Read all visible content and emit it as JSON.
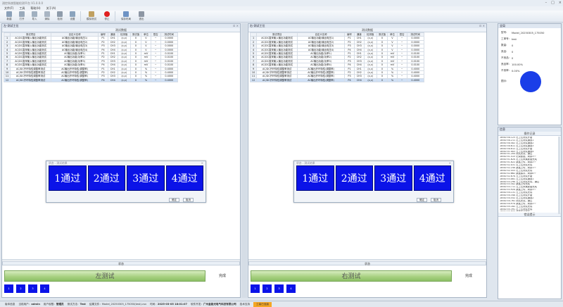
{
  "window": {
    "title": "测控系统智能检测平台 V1.0.0.0"
  },
  "menu": [
    "文件(F)",
    "工具",
    "帮助(H)",
    "关于(A)"
  ],
  "toolbar": [
    {
      "label": "新建",
      "icon": "new-file-icon",
      "color": "#8aa0b8"
    },
    {
      "label": "打开",
      "icon": "open-icon",
      "color": "#9aaabb"
    },
    {
      "label": "导入",
      "icon": "import-icon",
      "color": "#a0b0c0"
    },
    {
      "label": "清除",
      "icon": "clear-icon",
      "color": "#a9b5c3"
    },
    {
      "label": "检测",
      "icon": "check-icon",
      "color": "#8f9cab"
    },
    {
      "label": "设置",
      "icon": "settings-icon",
      "color": "#8aa3bd"
    },
    {
      "label": "模拟测试",
      "icon": "simulate-icon",
      "color": "#c0a060"
    },
    {
      "label": "停止",
      "icon": "stop-icon",
      "color": "#e02020"
    },
    {
      "label": "保存布局",
      "icon": "save-layout-icon",
      "color": "#6e93c4"
    },
    {
      "label": "退出",
      "icon": "exit-icon",
      "color": "#8d96a3"
    }
  ],
  "left": {
    "title": "左-测试工位",
    "section": "测试数据",
    "dialog": {
      "title": "状态 - 测试结果",
      "ok": "确定",
      "cancel": "取消"
    },
    "tiles": [
      "1通过",
      "2通过",
      "3通过",
      "4通过"
    ],
    "state_header": "状态",
    "test_button": "左测试",
    "done": "完成",
    "channels": [
      "1",
      "2",
      "3",
      "4"
    ]
  },
  "right": {
    "title": "右-测试工位",
    "section": "测试数据",
    "dialog": {
      "title": "状态 - 测试结果",
      "ok": "确定",
      "cancel": "取消"
    },
    "tiles": [
      "1通过",
      "2通过",
      "3通过",
      "4通过"
    ],
    "state_header": "状态",
    "test_button": "右测试",
    "done": "完成",
    "channels": [
      "1",
      "2",
      "3",
      "4"
    ]
  },
  "table": {
    "headers": [
      "",
      "测试项目",
      "自定义名称",
      "编号",
      "通道",
      "检测值",
      "测试值",
      "单位",
      "是否",
      "测试时间"
    ],
    "rows": [
      [
        "1",
        "AC/DC直采输入输出功能测试",
        "AC输出功能(输出电压1)",
        "P1",
        "CH1",
        "(x,x)",
        "0",
        "V",
        "~",
        "0.0000"
      ],
      [
        "2",
        "AC/DC直采输入输出功能测试",
        "AC输出功能(输出电压2)",
        "P2",
        "CH2",
        "(x,x)",
        "0",
        "V",
        "~",
        "0.0000"
      ],
      [
        "3",
        "AC/DC直采输入输出功能测试",
        "AC输出功能(输出电压3)",
        "P3",
        "CH3",
        "(x,x)",
        "0",
        "V",
        "~",
        "0.0000"
      ],
      [
        "4",
        "AC/DC直采输入输出功能测试",
        "AC输出功能(输出电压4)",
        "P4",
        "CH4",
        "(x,x)",
        "0",
        "V",
        "~",
        "0.0000"
      ],
      [
        "5",
        "AC/DC直采输入输出功能测试",
        "AC输出功能(功率1)",
        "P1",
        "CH1",
        "(x,x)",
        "0",
        "mV",
        "~",
        "0.0100"
      ],
      [
        "6",
        "AC/DC直采输入输出功能测试",
        "AC输出功能(功率2)",
        "P2",
        "CH2",
        "(x,x)",
        "0",
        "mV",
        "~",
        "0.0100"
      ],
      [
        "7",
        "AC/DC直采输入输出功能测试",
        "AC输出功能(功率3)",
        "P3",
        "CH3",
        "(x,x)",
        "0",
        "mV",
        "~",
        "0.0100"
      ],
      [
        "8",
        "AC/DC直采输入输出功能测试",
        "AC输出功能(功率4)",
        "P4",
        "CH4",
        "(x,x)",
        "0",
        "mV",
        "~",
        "0.0100"
      ],
      [
        "9",
        "AC/DC开环特性调整率测试",
        "AC输出开环特性(调整率)",
        "P1",
        "CH1",
        "(x,x)",
        "0",
        "%",
        "~",
        "0.4000"
      ],
      [
        "10",
        "AC/DC开环特性调整率测试",
        "AC输出开环特性(调整率)",
        "P2",
        "CH2",
        "(x,x)",
        "0",
        "%",
        "~",
        "0.4000"
      ],
      [
        "11",
        "AC/DC开环特性调整率测试",
        "AC输出开环特性(调整率)",
        "P3",
        "CH3",
        "(x,x)",
        "0",
        "%",
        "~",
        "0.4000"
      ],
      [
        "12",
        "AC/DC开环特性调整率测试",
        "AC输出开环特性(调整率)",
        "P4",
        "CH4",
        "(x,x)",
        "0",
        "%",
        "~",
        "0.4000"
      ]
    ]
  },
  "info": {
    "title": "全局",
    "fields": [
      {
        "k": "型号:",
        "v": "Model_20250305_175050"
      },
      {
        "k": "工单号:",
        "v": "test"
      },
      {
        "k": "数量:",
        "v": "0"
      },
      {
        "k": "良品:",
        "v": "0"
      },
      {
        "k": "不良品:",
        "v": "0"
      },
      {
        "k": "良品率:",
        "v": "100.00%"
      },
      {
        "k": "不良率:",
        "v": "0.00%"
      }
    ],
    "chart_label": "图示:",
    "chart_color": "#1a3ee8"
  },
  "log": {
    "title": "信息",
    "header": "操作记录",
    "lines": [
      "18:00:50.123 右工位测试开始",
      "18:00:50.211 右工位测试通道1",
      "18:00:50.402 右工位测试通道2",
      "18:00:50.611 右工位测试通道3",
      "18:00:50.812 左工位测试开始",
      "18:00:51.003 左工位测试通道4",
      "18:00:51.204 测试完成，通过",
      "18:00:51.415 记录数据，剩余3个",
      "18:00:51.620 右工位采集数据完成",
      "18:00:51.822 数据上传，剩余2个",
      "18:00:52.031 右工位测试完成",
      "18:00:52.240 数据上传，剩余1个",
      "18:00:52.453 右工位测试完成",
      "18:00:52.662 数据保存，剩余0个",
      "18:00:52.870 左工位测试开始",
      "18:00:53.081 左工位测试通道1",
      "18:00:53.290 左工位测试完成，通过",
      "18:00:53.502 数据上传完成",
      "18:00:53.711 左工位采集数据完成",
      "18:00:53.920 数据上传，剩余3个",
      "18:00:54.131 左工位测试完成",
      "18:00:54.340 右工位测试开始",
      "18:00:54.552 右工位测试通道2",
      "18:00:54.761 测试完成，通过",
      "18:00:54.970 数据上传，剩余2个",
      "18:00:55.182 左工位测试完成",
      "18:00:55.391 右工位测试完成",
      "18:00:55.600 数据保存完成",
      "18:00:55.812 左工位数据保存",
      "18:00:56.021 右工位数据保存",
      "18:00:56.230 全部测试完成"
    ],
    "footer_header": "错误提示"
  },
  "status": {
    "version": "版本信息",
    "user_label": "当前用户：",
    "user": "admin",
    "perm_label": "用户权限：",
    "perm": "管理员",
    "mode_label": "测试方法：",
    "mode": "Test",
    "file_label": "结果文件：",
    "file": "Model_20250305_175050(test).csv",
    "time_label": "时间：",
    "time": "2025-03-05 18:01:07",
    "company_label": "软件开发：",
    "company": "广州金能光电气科技有限公司",
    "contact": "技术支持",
    "badge": "工装已连接"
  }
}
